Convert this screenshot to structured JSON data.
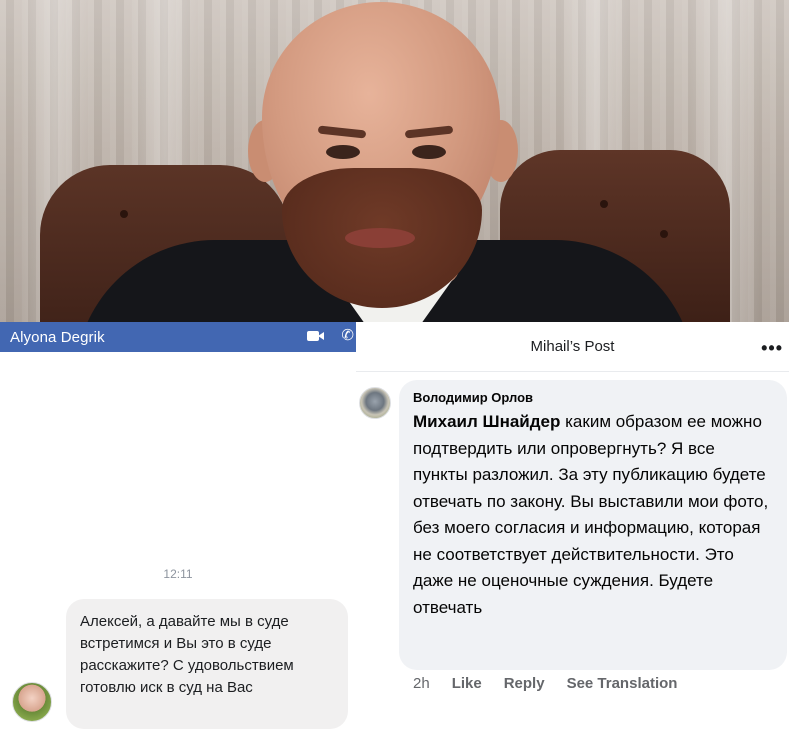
{
  "photo": {
    "description_icon": "person-photo"
  },
  "messenger": {
    "contact_name": "Alyona Degrik",
    "header_color": "#4267b2",
    "icons": [
      "video-call-icon",
      "phone-call-icon"
    ],
    "timestamp": "12:11",
    "message": "Алексей, а давайте мы в суде встретимся и Вы это в суде расскажите? С удовольствием готовлю иск в суд на Вас"
  },
  "post": {
    "title": "Mihail’s Post",
    "more_label": "•••",
    "comment": {
      "author": "Володимир Орлов",
      "mention": "Михаил Шнайдер",
      "text": " каким образом ее можно подтвердить или опровергнуть? Я все пункты разложил. За эту публикацию будете отвечать по закону. Вы выставили мои фото, без моего согласия и информацию, которая не соответствует действительности. Это даже не оценочные суждения. Будете отвечать"
    },
    "actions": {
      "time": "2h",
      "like": "Like",
      "reply": "Reply",
      "see_translation": "See Translation"
    }
  }
}
